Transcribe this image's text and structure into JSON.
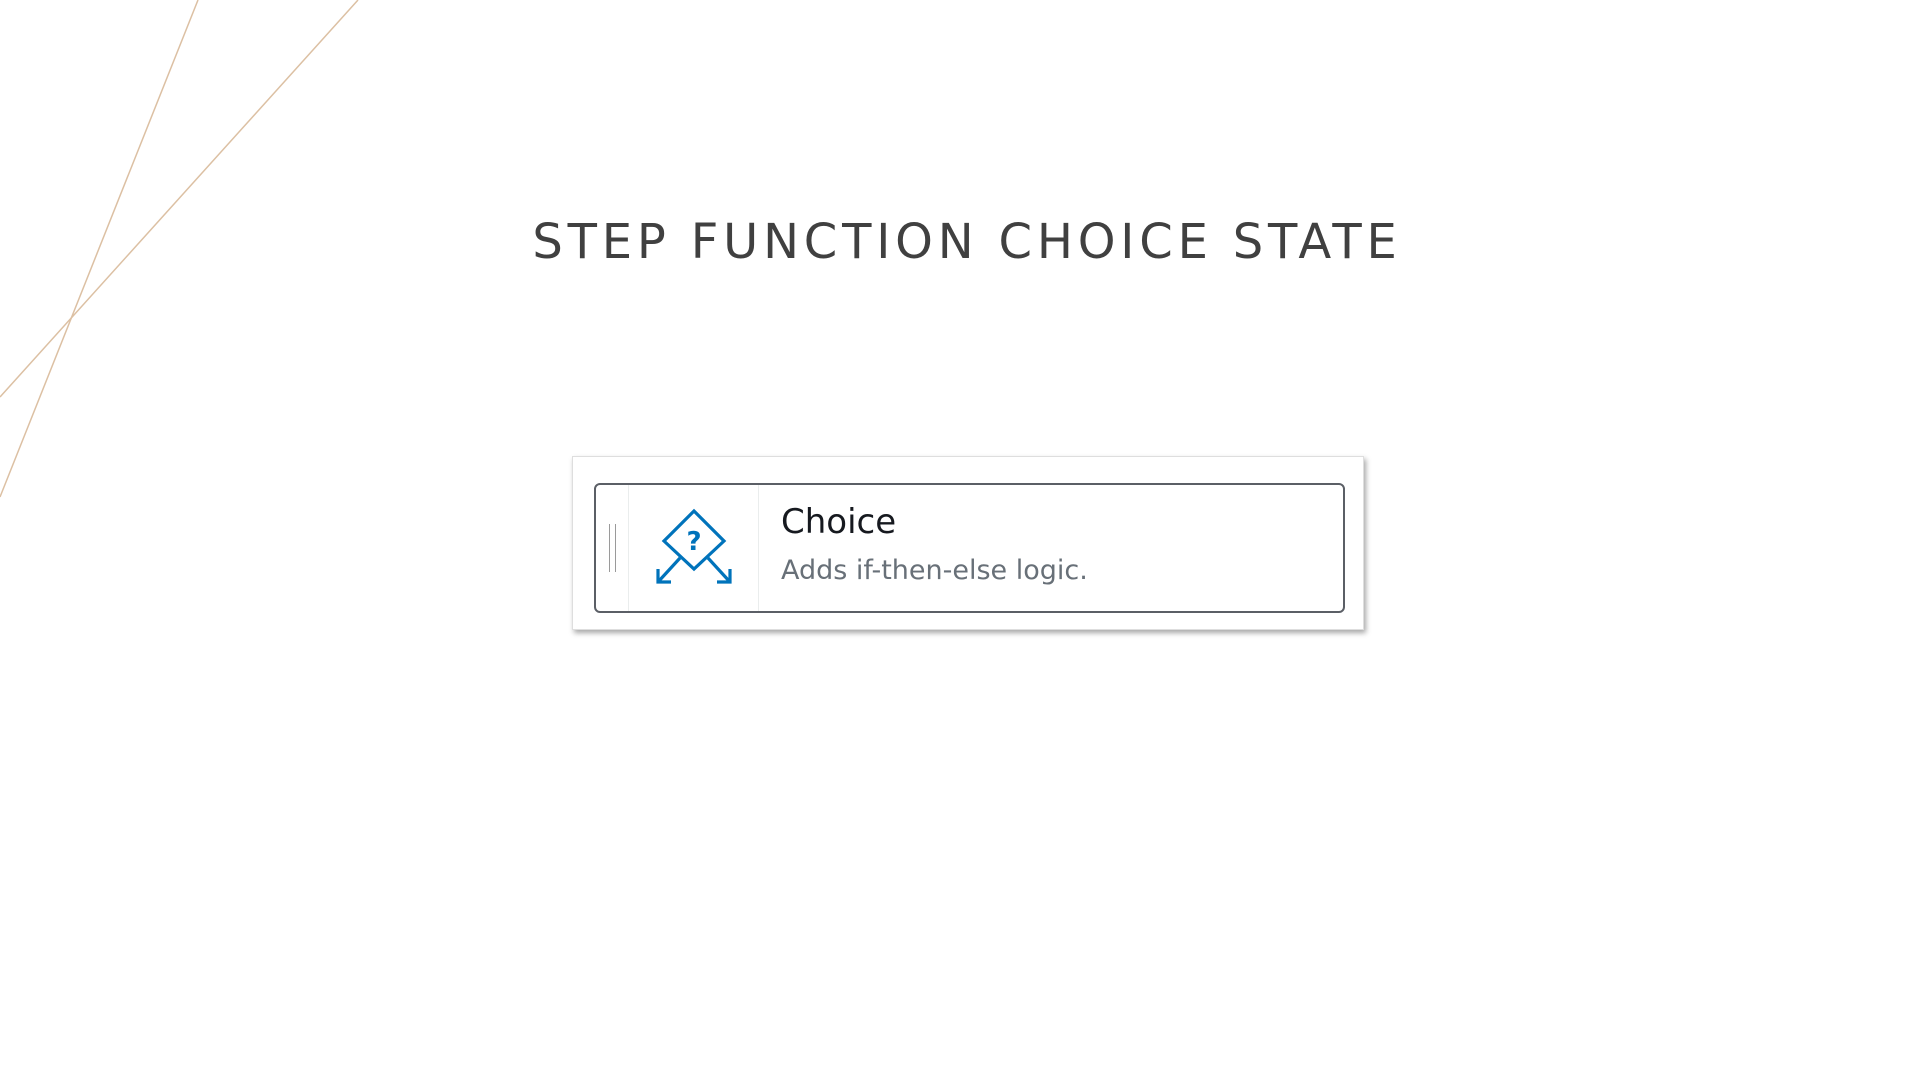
{
  "slide": {
    "title": "STEP FUNCTION CHOICE STATE"
  },
  "state_card": {
    "name": "Choice",
    "description": "Adds if-then-else logic.",
    "icon": "choice-diamond-icon",
    "icon_glyph": "?",
    "icon_color": "#0073bb"
  },
  "colors": {
    "title": "#404040",
    "decorative_lines": "#d9b99b",
    "card_border": "#5b5f66",
    "description": "#687078"
  }
}
